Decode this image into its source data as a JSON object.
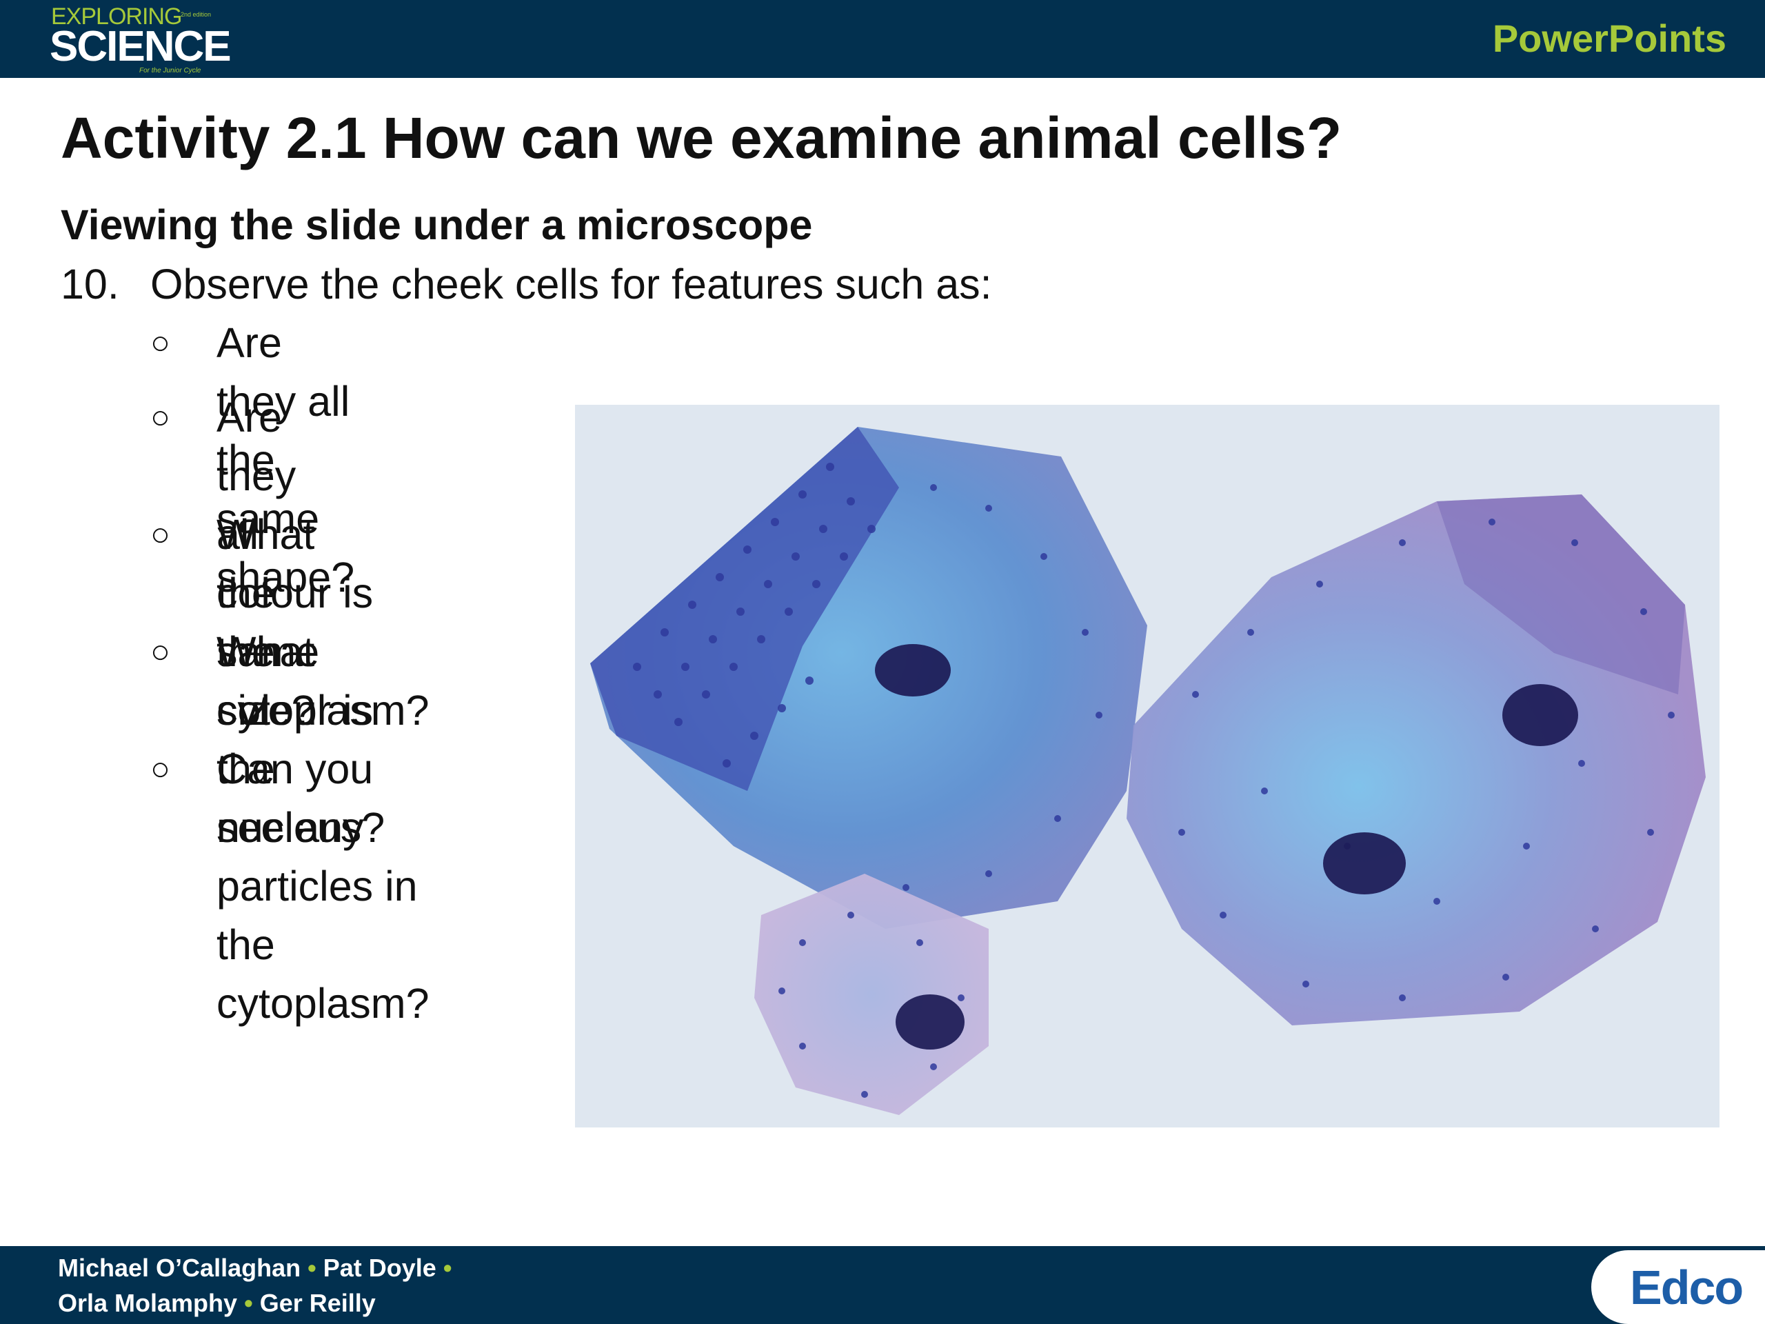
{
  "header": {
    "logo": {
      "line1": "EXPLORING",
      "edition": "2nd edition",
      "line2": "SCIENCE",
      "tagline": "For the Junior Cycle"
    },
    "section_label": "PowerPoints"
  },
  "slide": {
    "title": "Activity 2.1 How can we examine animal cells?",
    "subtitle": "Viewing the slide under a microscope",
    "step": {
      "number": "10.",
      "text": "Observe the cheek cells for features such as:"
    },
    "bullet_marker": "○",
    "bullets": [
      "Are they all the same shape?",
      "Are they all the\nsame size?",
      "What colour is\nthe cytoplasm?",
      "What colour is\nthe nucleus?",
      "Can you see any\nparticles in the\ncytoplasm?"
    ]
  },
  "footer": {
    "authors_line1": [
      "Michael O’Callaghan",
      "Pat Doyle"
    ],
    "authors_line2": [
      "Orla Molamphy",
      "Ger Reilly"
    ],
    "separator": "•",
    "publisher": "Edco"
  },
  "colors": {
    "bar": "#02304f",
    "accent_green": "#a6c93a",
    "publisher_blue": "#1d5ea8",
    "cell_stain_light": "#8fc6ea",
    "cell_stain_dark": "#3a3f9e",
    "nucleus": "#1c1a55"
  }
}
